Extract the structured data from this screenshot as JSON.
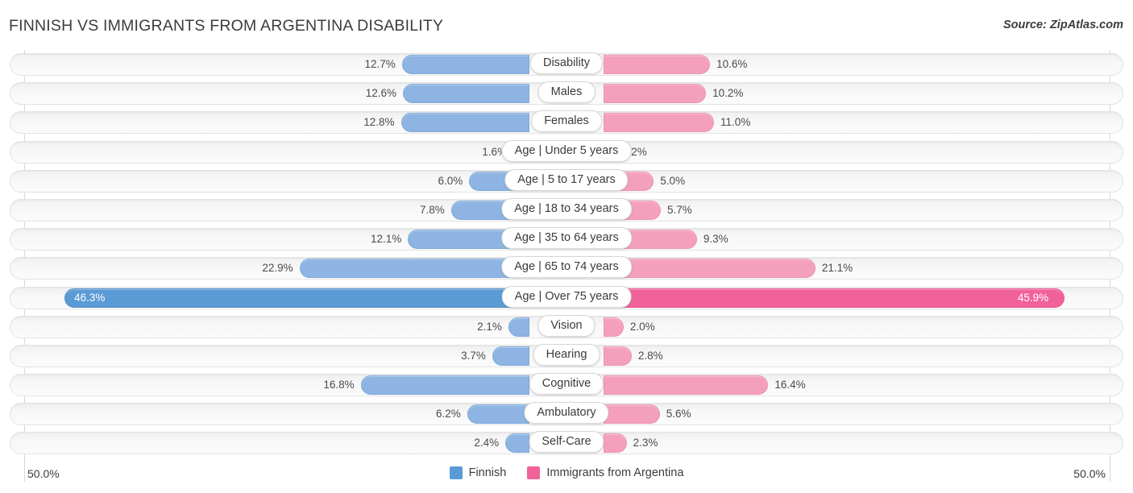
{
  "header": {
    "title": "FINNISH VS IMMIGRANTS FROM ARGENTINA DISABILITY",
    "source": "Source: ZipAtlas.com"
  },
  "axis": {
    "left_label": "50.0%",
    "right_label": "50.0%",
    "max": 50.0
  },
  "legend": {
    "items": [
      {
        "label": "Finnish",
        "color": "#5b9bd5",
        "swatch": "finnish"
      },
      {
        "label": "Immigrants from Argentina",
        "color": "#f2629a",
        "swatch": "argentina"
      }
    ]
  },
  "colors": {
    "left_bar": "#8db4e2",
    "right_bar": "#f4a0bd",
    "left_bar_strong": "#5b9bd5",
    "right_bar_strong": "#f2629a",
    "track": "#f5f5f5",
    "gridline": "#d8d8d8",
    "text": "#3c3c3c"
  },
  "chart_data": {
    "type": "bar",
    "title": "FINNISH VS IMMIGRANTS FROM ARGENTINA DISABILITY",
    "subtitle": "Source: ZipAtlas.com",
    "orientation": "horizontal-diverging",
    "xlabel": "",
    "ylabel": "",
    "xlim": [
      50.0,
      50.0
    ],
    "grid": true,
    "legend_position": "bottom-center",
    "categories": [
      "Disability",
      "Males",
      "Females",
      "Age | Under 5 years",
      "Age | 5 to 17 years",
      "Age | 18 to 34 years",
      "Age | 35 to 64 years",
      "Age | 65 to 74 years",
      "Age | Over 75 years",
      "Vision",
      "Hearing",
      "Cognitive",
      "Ambulatory",
      "Self-Care"
    ],
    "series": [
      {
        "name": "Finnish",
        "color": "#5b9bd5",
        "values": [
          12.7,
          12.6,
          12.8,
          1.6,
          6.0,
          7.8,
          12.1,
          22.9,
          46.3,
          2.1,
          3.7,
          16.8,
          6.2,
          2.4
        ]
      },
      {
        "name": "Immigrants from Argentina",
        "color": "#f2629a",
        "values": [
          10.6,
          10.2,
          11.0,
          1.2,
          5.0,
          5.7,
          9.3,
          21.1,
          45.9,
          2.0,
          2.8,
          16.4,
          5.6,
          2.3
        ]
      }
    ]
  },
  "rows": [
    {
      "label": "Disability",
      "left": "12.7%",
      "right": "10.6%",
      "left_val": 12.7,
      "right_val": 10.6,
      "highlight": false
    },
    {
      "label": "Males",
      "left": "12.6%",
      "right": "10.2%",
      "left_val": 12.6,
      "right_val": 10.2,
      "highlight": false
    },
    {
      "label": "Females",
      "left": "12.8%",
      "right": "11.0%",
      "left_val": 12.8,
      "right_val": 11.0,
      "highlight": false
    },
    {
      "label": "Age | Under 5 years",
      "left": "1.6%",
      "right": "1.2%",
      "left_val": 1.6,
      "right_val": 1.2,
      "highlight": false
    },
    {
      "label": "Age | 5 to 17 years",
      "left": "6.0%",
      "right": "5.0%",
      "left_val": 6.0,
      "right_val": 5.0,
      "highlight": false
    },
    {
      "label": "Age | 18 to 34 years",
      "left": "7.8%",
      "right": "5.7%",
      "left_val": 7.8,
      "right_val": 5.7,
      "highlight": false
    },
    {
      "label": "Age | 35 to 64 years",
      "left": "12.1%",
      "right": "9.3%",
      "left_val": 12.1,
      "right_val": 9.3,
      "highlight": false
    },
    {
      "label": "Age | 65 to 74 years",
      "left": "22.9%",
      "right": "21.1%",
      "left_val": 22.9,
      "right_val": 21.1,
      "highlight": false
    },
    {
      "label": "Age | Over 75 years",
      "left": "46.3%",
      "right": "45.9%",
      "left_val": 46.3,
      "right_val": 45.9,
      "highlight": true
    },
    {
      "label": "Vision",
      "left": "2.1%",
      "right": "2.0%",
      "left_val": 2.1,
      "right_val": 2.0,
      "highlight": false
    },
    {
      "label": "Hearing",
      "left": "3.7%",
      "right": "2.8%",
      "left_val": 3.7,
      "right_val": 2.8,
      "highlight": false
    },
    {
      "label": "Cognitive",
      "left": "16.8%",
      "right": "16.4%",
      "left_val": 16.8,
      "right_val": 16.4,
      "highlight": false
    },
    {
      "label": "Ambulatory",
      "left": "6.2%",
      "right": "5.6%",
      "left_val": 6.2,
      "right_val": 5.6,
      "highlight": false
    },
    {
      "label": "Self-Care",
      "left": "2.4%",
      "right": "2.3%",
      "left_val": 2.4,
      "right_val": 2.3,
      "highlight": false
    }
  ]
}
